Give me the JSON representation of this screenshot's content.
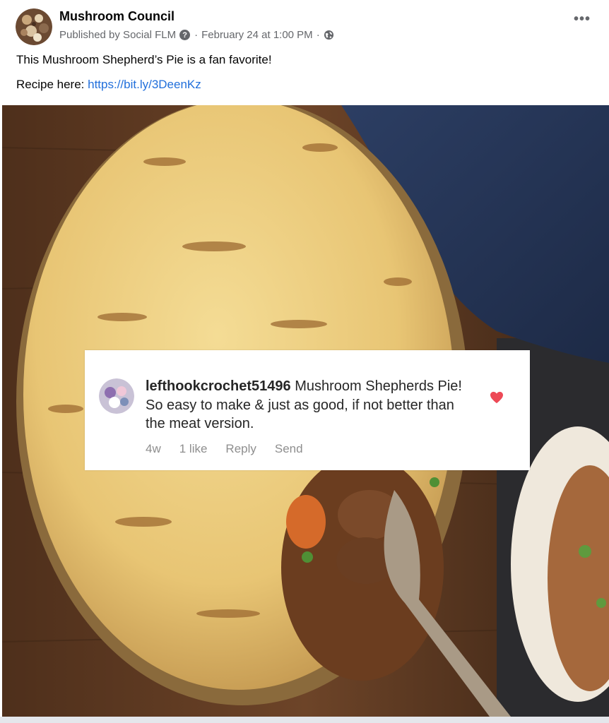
{
  "post": {
    "page_name": "Mushroom Council",
    "published_by": "Published by Social FLM",
    "separator": "·",
    "timestamp": "February 24 at 1:00 PM",
    "more_icon": "more-horizontal-icon",
    "caption": "This Mushroom Shepherd’s Pie is a fan favorite!",
    "recipe_label": "Recipe here: ",
    "recipe_link": "https://bit.ly/3DeenKz"
  },
  "photo": {
    "description_icon": "shepherds-pie-photo",
    "comment": {
      "username": "lefthookcrochet51496",
      "text": "Mushroom Shepherds Pie! So easy to make & just as good, if not better than the meat version.",
      "age": "4w",
      "likes": "1 like",
      "reply_label": "Reply",
      "send_label": "Send",
      "heart_color": "#ed4956"
    }
  },
  "colors": {
    "link": "#216fdb",
    "secondary_text": "#65676b"
  }
}
